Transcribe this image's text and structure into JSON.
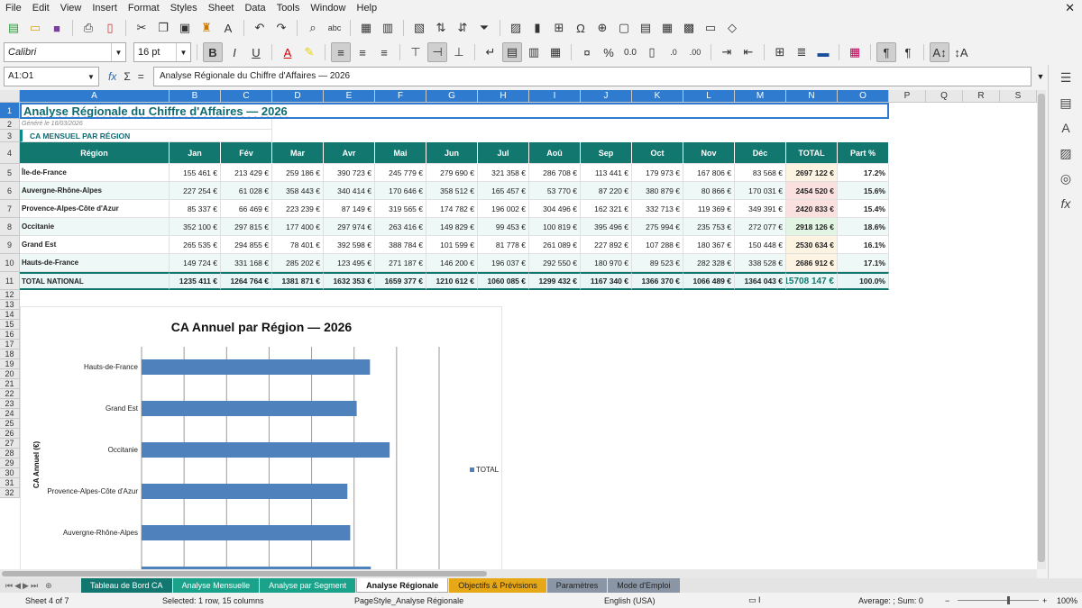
{
  "menu": [
    "File",
    "Edit",
    "View",
    "Insert",
    "Format",
    "Styles",
    "Sheet",
    "Data",
    "Tools",
    "Window",
    "Help"
  ],
  "format": {
    "font_name": "Calibri",
    "font_size": "16 pt"
  },
  "formula": {
    "cell_ref": "A1:O1",
    "content": "Analyse Régionale du Chiffre d'Affaires — 2026"
  },
  "columns": [
    "A",
    "B",
    "C",
    "D",
    "E",
    "F",
    "G",
    "H",
    "I",
    "J",
    "K",
    "L",
    "M",
    "N",
    "O",
    "P",
    "Q",
    "R",
    "S"
  ],
  "rows": [
    "1",
    "2",
    "3",
    "4",
    "5",
    "6",
    "7",
    "8",
    "9",
    "10",
    "11",
    "12",
    "13",
    "14",
    "15",
    "16",
    "17",
    "18",
    "19",
    "20",
    "21",
    "22",
    "23",
    "24",
    "25",
    "26",
    "27",
    "28",
    "29",
    "30",
    "31",
    "32"
  ],
  "sheet": {
    "title": "Analyse Régionale du Chiffre d'Affaires — 2026",
    "generated": "Généré le 16/03/2026",
    "section": "CA MENSUEL PAR RÉGION",
    "headers": [
      "Région",
      "Jan",
      "Fév",
      "Mar",
      "Avr",
      "Mai",
      "Jun",
      "Jul",
      "Aoû",
      "Sep",
      "Oct",
      "Nov",
      "Déc",
      "TOTAL",
      "Part %"
    ],
    "table": [
      {
        "region": "Île-de-France",
        "months": [
          "155 461 €",
          "213 429 €",
          "259 186 €",
          "390 723 €",
          "245 779 €",
          "279 690 €",
          "321 358 €",
          "286 708 €",
          "113 441 €",
          "179 973 €",
          "167 806 €",
          "83 568 €"
        ],
        "total": "2697 122 €",
        "pct": "17.2%"
      },
      {
        "region": "Auvergne-Rhône-Alpes",
        "months": [
          "227 254 €",
          "61 028 €",
          "358 443 €",
          "340 414 €",
          "170 646 €",
          "358 512 €",
          "165 457 €",
          "53 770 €",
          "87 220 €",
          "380 879 €",
          "80 866 €",
          "170 031 €"
        ],
        "total": "2454 520 €",
        "pct": "15.6%"
      },
      {
        "region": "Provence-Alpes-Côte d'Azur",
        "months": [
          "85 337 €",
          "66 469 €",
          "223 239 €",
          "87 149 €",
          "319 565 €",
          "174 782 €",
          "196 002 €",
          "304 496 €",
          "162 321 €",
          "332 713 €",
          "119 369 €",
          "349 391 €"
        ],
        "total": "2420 833 €",
        "pct": "15.4%"
      },
      {
        "region": "Occitanie",
        "months": [
          "352 100 €",
          "297 815 €",
          "177 400 €",
          "297 974 €",
          "263 416 €",
          "149 829 €",
          "99 453 €",
          "100 819 €",
          "395 496 €",
          "275 994 €",
          "235 753 €",
          "272 077 €"
        ],
        "total": "2918 126 €",
        "pct": "18.6%"
      },
      {
        "region": "Grand Est",
        "months": [
          "265 535 €",
          "294 855 €",
          "78 401 €",
          "392 598 €",
          "388 784 €",
          "101 599 €",
          "81 778 €",
          "261 089 €",
          "227 892 €",
          "107 288 €",
          "180 367 €",
          "150 448 €"
        ],
        "total": "2530 634 €",
        "pct": "16.1%"
      },
      {
        "region": "Hauts-de-France",
        "months": [
          "149 724 €",
          "331 168 €",
          "285 202 €",
          "123 495 €",
          "271 187 €",
          "146 200 €",
          "196 037 €",
          "292 550 €",
          "180 970 €",
          "89 523 €",
          "282 328 €",
          "338 528 €"
        ],
        "total": "2686 912 €",
        "pct": "17.1%"
      }
    ],
    "total_row": {
      "label": "TOTAL NATIONAL",
      "months": [
        "1235 411 €",
        "1264 764 €",
        "1381 871 €",
        "1632 353 €",
        "1659 377 €",
        "1210 612 €",
        "1060 085 €",
        "1299 432 €",
        "1167 340 €",
        "1366 370 €",
        "1066 489 €",
        "1364 043 €"
      ],
      "total": "15708 147 €",
      "pct": "100.0%"
    }
  },
  "chart_data": {
    "type": "bar",
    "orientation": "horizontal",
    "title": "CA Annuel par Région — 2026",
    "ylabel": "CA Annuel (€)",
    "categories": [
      "Hauts-de-France",
      "Grand Est",
      "Occitanie",
      "Provence-Alpes-Côte d'Azur",
      "Auvergne-Rhône-Alpes"
    ],
    "series": [
      {
        "name": "TOTAL",
        "values": [
          2686912,
          2530634,
          2918126,
          2420833,
          2454520
        ]
      }
    ],
    "xlim": [
      0,
      3500000
    ],
    "color": "#4f81bd",
    "legend": "right"
  },
  "tabs": [
    {
      "label": "Tableau de Bord CA",
      "color": "#12786f"
    },
    {
      "label": "Analyse Mensuelle",
      "color": "#1aa38a"
    },
    {
      "label": "Analyse par Segment",
      "color": "#1aa38a"
    },
    {
      "label": "Analyse Régionale",
      "color": "#ffffff"
    },
    {
      "label": "Objectifs & Prévisions",
      "color": "#e6a817"
    },
    {
      "label": "Paramètres",
      "color": "#8a96a6"
    },
    {
      "label": "Mode d'Emploi",
      "color": "#8a96a6"
    }
  ],
  "status": {
    "sheet": "Sheet 4 of 7",
    "selection": "Selected: 1 row, 15 columns",
    "pagestyle": "PageStyle_Analyse Régionale",
    "language": "English (USA)",
    "sum": "Average: ; Sum: 0",
    "zoom": "100%"
  }
}
